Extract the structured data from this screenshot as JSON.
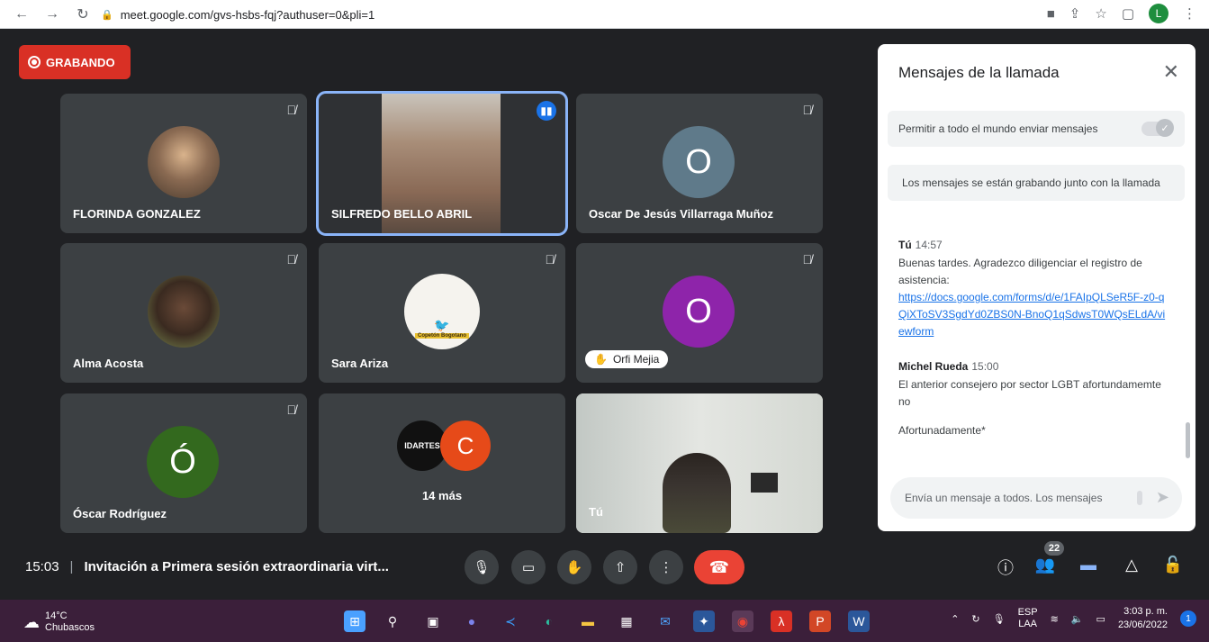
{
  "browser": {
    "url": "meet.google.com/gvs-hsbs-fqj?authuser=0&pli=1",
    "profile_initial": "L"
  },
  "recording": {
    "label": "GRABANDO"
  },
  "tiles": [
    {
      "name": "FLORINDA GONZALEZ"
    },
    {
      "name": "SILFREDO BELLO ABRIL"
    },
    {
      "name": "Oscar De Jesús Villarraga Muñoz",
      "initial": "O"
    },
    {
      "name": "Alma Acosta"
    },
    {
      "name": "Sara Ariza",
      "avatar_text": "Copetón Bogotano"
    },
    {
      "chip": "Orfi Mejia",
      "initial": "O"
    },
    {
      "name": "Óscar Rodríguez",
      "initial": "Ó"
    },
    {
      "more": "14 más",
      "initial": "C",
      "logo_text": "IDARTES"
    },
    {
      "name": "Tú"
    }
  ],
  "chat": {
    "title": "Mensajes de la llamada",
    "permission_label": "Permitir a todo el mundo enviar mensajes",
    "recording_note": "Los mensajes se están grabando junto con la llamada",
    "messages": [
      {
        "sender": "Tú",
        "time": "14:57",
        "text": "Buenas tardes. Agradezco diligenciar el registro de asistencia:",
        "link": "https://docs.google.com/forms/d/e/1FAIpQLSeR5F-z0-qQiXToSV3SgdYd0ZBS0N-BnoQ1qSdwsT0WQsELdA/viewform"
      },
      {
        "sender": "Michel Rueda",
        "time": "15:00",
        "lines": [
          "El anterior consejero por sector LGBT afortundamemte no",
          "Afortunadamente*"
        ]
      }
    ],
    "input_placeholder": "Envía un mensaje a todos. Los mensajes"
  },
  "bottom": {
    "time": "15:03",
    "meeting_title": "Invitación a Primera sesión extraordinaria virt...",
    "participants_badge": "22"
  },
  "taskbar": {
    "temperature": "14°C",
    "weather": "Chubascos",
    "lang_top": "ESP",
    "lang_bottom": "LAA",
    "clock_time": "3:03 p. m.",
    "clock_date": "23/06/2022",
    "notification_count": "1"
  },
  "colors": {
    "record_red": "#d93025",
    "end_call_red": "#ea4335",
    "meet_bg": "#202124",
    "tile_bg": "#3c4043",
    "accent_blue": "#1a73e8",
    "taskbar_bg": "#3b1f3a"
  }
}
